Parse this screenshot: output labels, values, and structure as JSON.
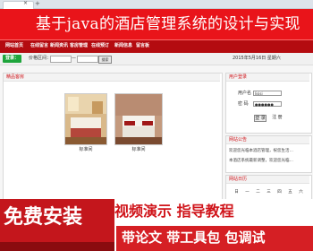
{
  "browser": {
    "tab_close": "×",
    "new_tab": "+"
  },
  "header": {
    "title": "基于java的酒店管理系统的设计与实现"
  },
  "nav": {
    "items": [
      {
        "label": "网站首页"
      },
      {
        "label": "在线留言"
      },
      {
        "label": "新闻资讯"
      },
      {
        "label": "客房管理"
      },
      {
        "label": "在线预订"
      },
      {
        "label": "新闻信息"
      },
      {
        "label": "留言板"
      }
    ]
  },
  "search_bar": {
    "login_label": "登录：",
    "price_label": "价格区间：",
    "min_placeholder": "",
    "separator": "—",
    "max_placeholder": "",
    "search_button": "搜索",
    "date_text": "2015年5月16日 星期六"
  },
  "rooms_panel": {
    "title": "精品客房",
    "rooms": [
      {
        "name": "标准间"
      },
      {
        "name": "标准间"
      }
    ]
  },
  "login_panel": {
    "title": "用户登录",
    "username_label": "用户名",
    "username_value": "lisisi",
    "password_label": "密 码",
    "password_value": "●●●●●●",
    "login_button": "登 录",
    "register_button": "注 册"
  },
  "notice_panel": {
    "title": "网站公告",
    "items": [
      "欢迎您光临本酒店管理，祝您生活…",
      "本酒店系统最新调整，欢迎您光临…"
    ]
  },
  "calendar_panel": {
    "title": "网站日历",
    "weekdays": [
      "日",
      "一",
      "二",
      "三",
      "四",
      "五",
      "六"
    ]
  },
  "promo": {
    "left_text": "免费安装",
    "line1": "视频演示 指导教程",
    "line2": "带论文 带工具包 包调试"
  },
  "colors": {
    "banner": "#e9141a",
    "nav": "#b40b10",
    "accent": "#d0141a",
    "login_green": "#1fa53c"
  },
  "icons": [
    "close-icon",
    "new-tab-icon"
  ]
}
